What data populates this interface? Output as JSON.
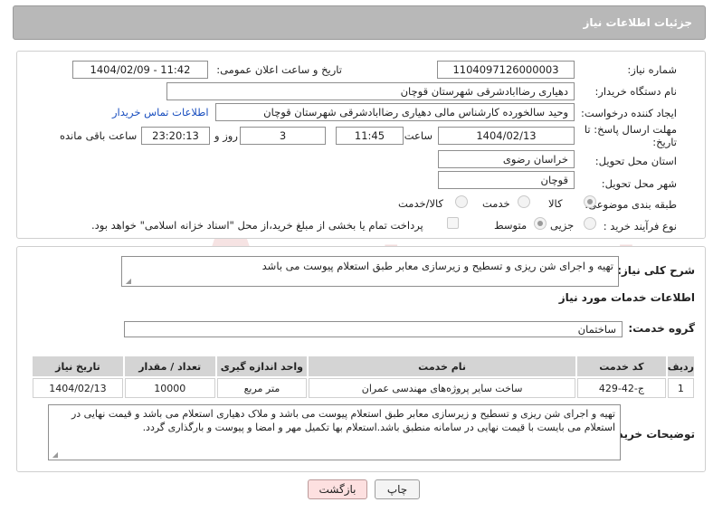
{
  "header": {
    "title": "جزئیات اطلاعات نیاز"
  },
  "form": {
    "need_number_label": "شماره نیاز:",
    "need_number": "1104097126000003",
    "announce_datetime_label": "تاریخ و ساعت اعلان عمومی:",
    "announce_datetime": "1404/02/09 - 11:42",
    "buyer_org_label": "نام دستگاه خریدار:",
    "buyer_org": "دهیاری رضاابادشرقی  شهرستان قوچان",
    "requester_label": "ایجاد کننده درخواست:",
    "requester": "وحید سالخورده کارشناس مالی دهیاری رضاابادشرقی  شهرستان قوچان",
    "buyer_contact_link": "اطلاعات تماس خریدار",
    "deadline_label_line1": "مهلت ارسال پاسخ: تا",
    "deadline_label_line2": "تاریخ:",
    "deadline_date": "1404/02/13",
    "time_label": "ساعت",
    "deadline_time": "11:45",
    "days_value": "3",
    "days_label": "روز و",
    "remaining_time": "23:20:13",
    "remaining_label": "ساعت باقی مانده",
    "province_label": "استان محل تحویل:",
    "province": "خراسان رضوی",
    "city_label": "شهر محل تحویل:",
    "city": "قوچان",
    "category_label": "طبقه بندی موضوعی:",
    "category_options": [
      "کالا",
      "خدمت",
      "کالا/خدمت"
    ],
    "category_selected": "کالا",
    "process_label": "نوع فرآیند خرید :",
    "process_options": [
      "جزیی",
      "متوسط"
    ],
    "process_selected": "متوسط",
    "payment_note": "پرداخت تمام یا بخشی از مبلغ خرید،از محل \"اسناد خزانه اسلامی\" خواهد بود."
  },
  "summary": {
    "label": "شرح کلی نیاز:",
    "text": "تهیه و اجرای شن ریزی و تسطیح و زیرسازی معابر طبق استعلام پیوست می باشد"
  },
  "services": {
    "section_title": "اطلاعات خدمات مورد نیاز",
    "group_label": "گروه خدمت:",
    "group_value": "ساختمان",
    "columns": [
      "ردیف",
      "کد خدمت",
      "نام خدمت",
      "واحد اندازه گیری",
      "تعداد / مقدار",
      "تاریخ نیاز"
    ],
    "rows": [
      [
        "1",
        "ج-42-429",
        "ساخت سایر پروژه‌های مهندسی عمران",
        "متر مربع",
        "10000",
        "1404/02/13"
      ]
    ]
  },
  "buyer_notes": {
    "label": "توضیحات خریدار:",
    "text": "تهیه و اجرای شن ریزی و تسطیح و زیرسازی معابر طبق استعلام پیوست می باشد و ملاک دهیاری استعلام می باشد و قیمت نهایی در استعلام می بایست با قیمت نهایی در سامانه منطبق باشد.استعلام بها تکمیل مهر و امضا و پیوست و بارگذاری گردد."
  },
  "actions": {
    "print": "چاپ",
    "back": "بازگشت"
  },
  "watermark": {
    "text": "AriaTender.neT",
    "color": "#e8b8b8"
  },
  "colors": {
    "link": "#1a4fbf",
    "titlebar": "#b8b8b8",
    "table_header": "#d4d4d4"
  }
}
